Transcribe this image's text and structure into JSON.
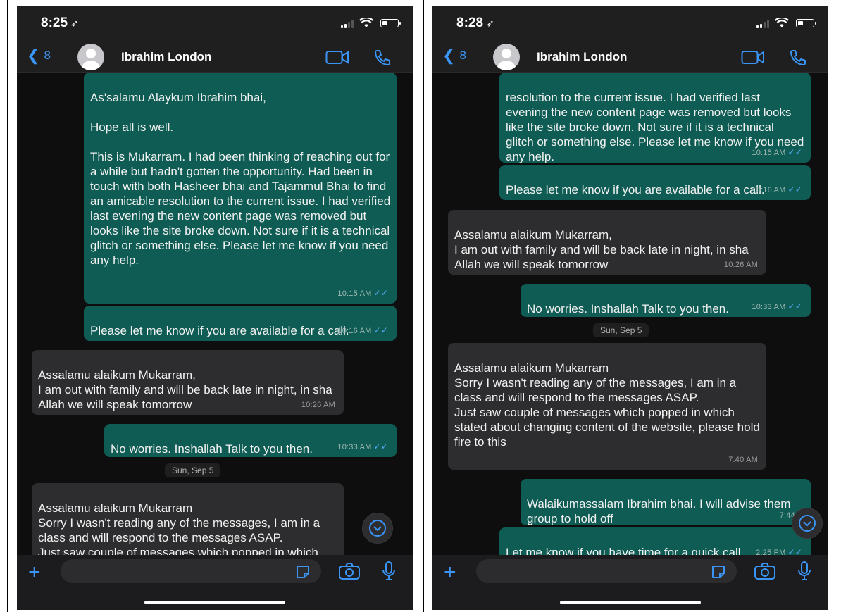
{
  "phones": [
    {
      "status": {
        "time": "8:25",
        "loc_glyph": "➶"
      },
      "header": {
        "back_count": "8",
        "contact": "Ibrahim London"
      },
      "composer": {
        "placeholder": ""
      }
    },
    {
      "status": {
        "time": "8:28",
        "loc_glyph": "➶"
      },
      "header": {
        "back_count": "8",
        "contact": "Ibrahim London"
      },
      "composer": {
        "placeholder": ""
      }
    }
  ],
  "left_messages": [
    {
      "dir": "out",
      "text": "As'salamu Alaykum Ibrahim bhai,\n\nHope all is well.\n\nThis is Mukarram. I had been thinking of reaching out for a while but hadn't gotten the opportunity. Had been in touch with both Hasheer bhai and Tajammul Bhai to find an amicable resolution to the current issue. I had verified last evening the new content page was removed but looks like the site broke down. Not sure if it is a technical glitch or something else. Please let me know if you need any help.",
      "time": "10:15 AM"
    },
    {
      "dir": "out",
      "text": "Please let me know if you are available for a call.",
      "time": "10:16 AM"
    },
    {
      "dir": "in",
      "text": "Assalamu alaikum Mukarram,\nI am out with family and will be back late in night, in sha Allah we will speak tomorrow",
      "time": "10:26 AM"
    },
    {
      "dir": "out",
      "text": "No worries. Inshallah Talk to you then.",
      "time": "10:33 AM"
    },
    {
      "dir": "in",
      "text": "Assalamu alaikum Mukarram\nSorry I wasn't reading any of the messages, I am in a class and will respond to the messages ASAP.\nJust saw couple of messages which popped in which stated about changing",
      "time": ""
    }
  ],
  "right_messages": [
    {
      "dir": "out",
      "text": "resolution to the current issue. I had verified last evening the new content page was removed but looks like the site broke down. Not sure if it is a technical glitch or something else. Please let me know if you need any help.",
      "time": "10:15 AM"
    },
    {
      "dir": "out",
      "text": "Please let me know if you are available for a call.",
      "time": "10:16 AM"
    },
    {
      "dir": "in",
      "text": "Assalamu alaikum Mukarram,\nI am out with family and will be back late in night, in sha Allah we will speak tomorrow",
      "time": "10:26 AM"
    },
    {
      "dir": "out",
      "text": "No worries. Inshallah Talk to you then.",
      "time": "10:33 AM"
    },
    {
      "dir": "in",
      "text": "Assalamu alaikum Mukarram\nSorry I wasn't reading any of the messages, I am in a class and will respond to the messages ASAP.\nJust saw couple of messages which popped in which stated about changing content of the website, please hold fire to this",
      "time": "7:40 AM"
    },
    {
      "dir": "out",
      "text": "Walaikumassalam Ibrahim bhai. I will advise them group to hold off",
      "time": "7:44 A"
    },
    {
      "dir": "out",
      "text": "Let me know if you have time for a quick call.",
      "time": "2:25 PM"
    }
  ],
  "date_separator": "Sun, Sep 5",
  "icons": {
    "back": "chevron-left-icon",
    "video": "video-camera-icon",
    "call": "phone-icon",
    "plus": "plus-icon",
    "sticker": "sticker-icon",
    "camera": "camera-icon",
    "mic": "microphone-icon",
    "scroll": "chevron-down-icon"
  },
  "colors": {
    "accent": "#3b95f6",
    "outgoing_bubble": "#0f5c54",
    "incoming_bubble": "#2d2d2f",
    "read_tick": "#53a9f4"
  }
}
